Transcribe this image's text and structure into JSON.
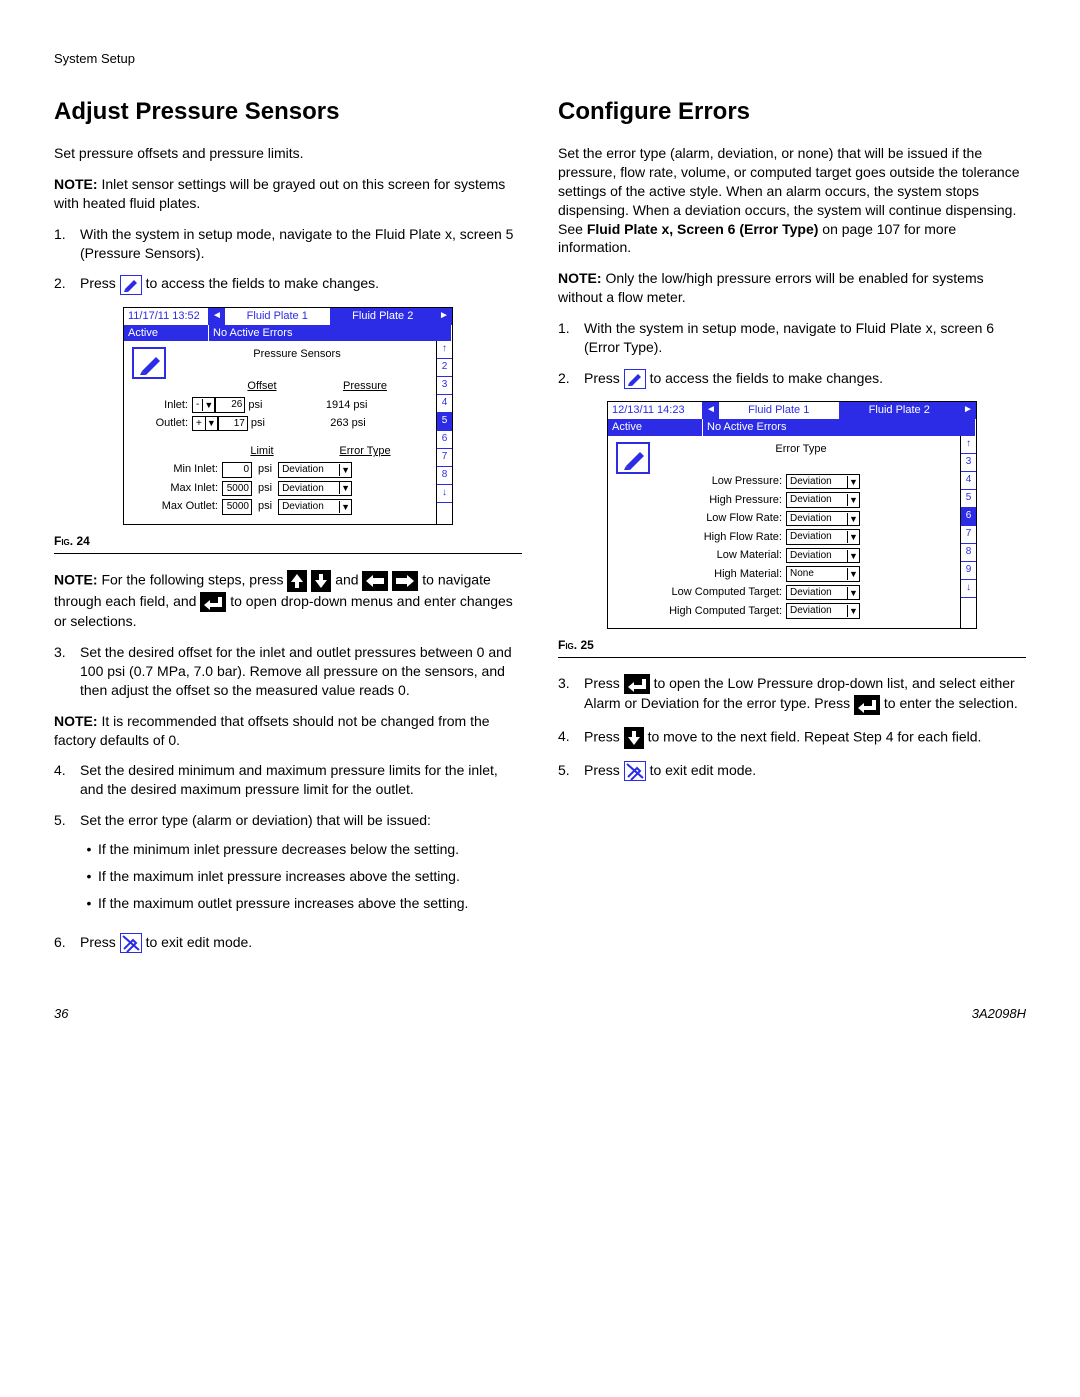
{
  "header": "System Setup",
  "left": {
    "heading": "Adjust Pressure Sensors",
    "intro": "Set pressure offsets and pressure limits.",
    "note1_label": "NOTE:",
    "note1": " Inlet sensor settings will be grayed out on this screen for systems with heated fluid plates.",
    "step1_num": "1.",
    "step1": "With the system in setup mode, navigate to the Fluid Plate x, screen 5 (Pressure Sensors).",
    "step2_num": "2.",
    "step2a": "Press ",
    "step2b": " to access the fields to make changes.",
    "fig24": "Fig. 24",
    "note2_label": "NOTE:",
    "note2a": " For the following steps, press ",
    "note2b": " and ",
    "note2c": " to navigate through each field, and ",
    "note2d": " to open drop-down menus and enter changes or selections.",
    "step3_num": "3.",
    "step3": "Set the desired offset for the inlet and outlet pressures between 0 and 100 psi (0.7 MPa, 7.0 bar). Remove all pressure on the sensors, and then adjust the offset so the measured value reads 0.",
    "note3_label": "NOTE:",
    "note3": " It is recommended that offsets should not be changed from the factory defaults of 0.",
    "step4_num": "4.",
    "step4": "Set the desired minimum and maximum pressure limits for the inlet, and the desired maximum pressure limit for the outlet.",
    "step5_num": "5.",
    "step5": "Set the error type (alarm or deviation) that will be issued:",
    "b1": "If the minimum inlet pressure decreases below the setting.",
    "b2": "If the maximum inlet pressure increases above the setting.",
    "b3": "If the maximum outlet pressure increases above the setting.",
    "step6_num": "6.",
    "step6a": "Press ",
    "step6b": " to exit edit mode.",
    "screen1": {
      "time": "11/17/11 13:52",
      "tab1": "Fluid Plate 1",
      "tab2": "Fluid Plate 2",
      "active": "Active",
      "errors": "No Active Errors",
      "title": "Pressure Sensors",
      "offset_h": "Offset",
      "pressure_h": "Pressure",
      "inlet_l": "Inlet:",
      "inlet_v": "26",
      "inlet_u": "psi",
      "inlet_p": "1914 psi",
      "outlet_l": "Outlet:",
      "outlet_v": "17",
      "outlet_u": "psi",
      "outlet_p": "263 psi",
      "limit_h": "Limit",
      "etype_h": "Error Type",
      "min_in_l": "Min Inlet:",
      "min_in_v": "0",
      "max_in_l": "Max Inlet:",
      "max_in_v": "5000",
      "max_out_l": "Max Outlet:",
      "max_out_v": "5000",
      "psi": "psi",
      "dev": "Deviation",
      "nums": [
        "↑",
        "2",
        "3",
        "4",
        "5",
        "6",
        "7",
        "8",
        "↓"
      ]
    }
  },
  "right": {
    "heading": "Configure Errors",
    "intro_a": "Set the error type (alarm, deviation, or none) that will be issued if the pressure, flow rate, volume, or computed target goes outside the tolerance settings of the active style. When an alarm occurs, the system stops dispensing. When a deviation occurs, the system will continue dispensing. See ",
    "intro_b": "Fluid Plate x, Screen 6 (Error Type)",
    "intro_c": " on page 107 for more information.",
    "note1_label": "NOTE:",
    "note1": " Only the low/high pressure errors will be enabled for systems without a flow meter.",
    "step1_num": "1.",
    "step1": "With the system in setup mode, navigate to Fluid Plate x, screen 6 (Error Type).",
    "step2_num": "2.",
    "step2a": "Press ",
    "step2b": " to access the fields to make changes.",
    "fig25": "Fig. 25",
    "step3_num": "3.",
    "step3a": "Press ",
    "step3b": " to open the Low Pressure drop-down list, and select either Alarm or Deviation for the error type. Press ",
    "step3c": " to enter the selection.",
    "step4_num": "4.",
    "step4a": "Press ",
    "step4b": " to move to the next field. Repeat Step 4 for each field.",
    "step5_num": "5.",
    "step5a": "Press ",
    "step5b": " to exit edit mode.",
    "screen2": {
      "time": "12/13/11 14:23",
      "tab1": "Fluid Plate 1",
      "tab2": "Fluid Plate 2",
      "active": "Active",
      "errors": "No Active Errors",
      "title": "Error Type",
      "rows": [
        {
          "l": "Low Pressure:",
          "v": "Deviation"
        },
        {
          "l": "High Pressure:",
          "v": "Deviation"
        },
        {
          "l": "Low Flow Rate:",
          "v": "Deviation"
        },
        {
          "l": "High Flow Rate:",
          "v": "Deviation"
        },
        {
          "l": "Low Material:",
          "v": "Deviation"
        },
        {
          "l": "High Material:",
          "v": "None"
        },
        {
          "l": "Low Computed Target:",
          "v": "Deviation"
        },
        {
          "l": "High Computed Target:",
          "v": "Deviation"
        }
      ],
      "nums": [
        "↑",
        "3",
        "4",
        "5",
        "6",
        "7",
        "8",
        "9",
        "↓"
      ]
    }
  },
  "footer": {
    "page": "36",
    "doc": "3A2098H"
  }
}
